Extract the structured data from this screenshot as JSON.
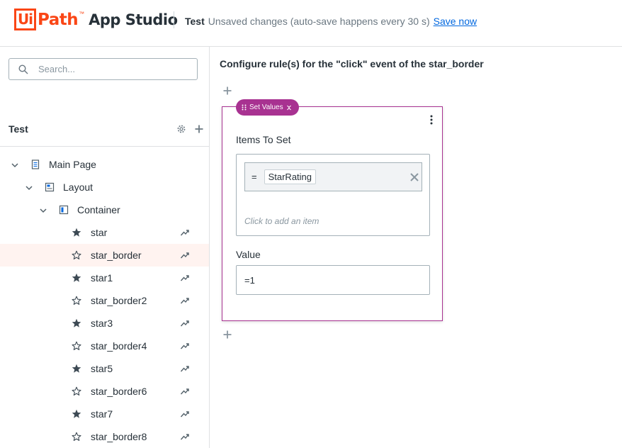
{
  "header": {
    "logo_box": "Ui",
    "logo_path": "Path",
    "logo_tm": "™",
    "logo_product": "App Studio",
    "app_name": "Test",
    "unsaved_text": "Unsaved changes (auto-save happens every 30 s)",
    "save_now": "Save now"
  },
  "sidebar": {
    "search_placeholder": "Search...",
    "tree_title": "Test",
    "tree": [
      {
        "label": "Main Page",
        "level": 0,
        "icon": "page-icon",
        "expanded": true
      },
      {
        "label": "Layout",
        "level": 1,
        "icon": "layout-icon",
        "expanded": true
      },
      {
        "label": "Container",
        "level": 2,
        "icon": "container-icon",
        "expanded": true
      },
      {
        "label": "star",
        "level": 3,
        "icon": "star-filled-icon",
        "selected": false
      },
      {
        "label": "star_border",
        "level": 3,
        "icon": "star-outline-icon",
        "selected": true
      },
      {
        "label": "star1",
        "level": 3,
        "icon": "star-filled-icon",
        "selected": false
      },
      {
        "label": "star_border2",
        "level": 3,
        "icon": "star-outline-icon",
        "selected": false
      },
      {
        "label": "star3",
        "level": 3,
        "icon": "star-filled-icon",
        "selected": false
      },
      {
        "label": "star_border4",
        "level": 3,
        "icon": "star-outline-icon",
        "selected": false
      },
      {
        "label": "star5",
        "level": 3,
        "icon": "star-filled-icon",
        "selected": false
      },
      {
        "label": "star_border6",
        "level": 3,
        "icon": "star-outline-icon",
        "selected": false
      },
      {
        "label": "star7",
        "level": 3,
        "icon": "star-filled-icon",
        "selected": false
      },
      {
        "label": "star_border8",
        "level": 3,
        "icon": "star-outline-icon",
        "selected": false
      }
    ]
  },
  "main": {
    "rule_title": "Configure rule(s) for the \"click\" event of the star_border",
    "card": {
      "tag": "Set Values",
      "items_label": "Items To Set",
      "item_eq": "=",
      "item_value": "StarRating",
      "add_item": "Click to add an item",
      "value_label": "Value",
      "value": "=1"
    }
  },
  "colors": {
    "brand": "#fa4616",
    "accent": "#a83291",
    "link": "#0067df",
    "selected_row": "#fff3f0"
  }
}
